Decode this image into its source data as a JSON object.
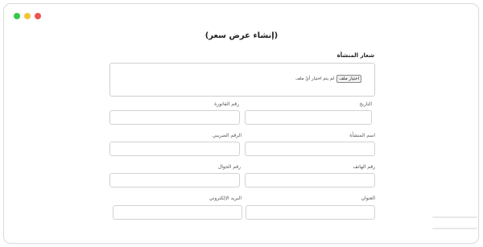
{
  "window": {
    "controls": [
      "green-light",
      "yellow-light",
      "red-light"
    ]
  },
  "page": {
    "title": "(إنشاء عرض سعر)"
  },
  "logo_section": {
    "label": "شعار المنشأة",
    "file_button": "اختيار ملف",
    "file_status": "لم يتم اختيار أيّ ملف"
  },
  "fields": {
    "date": {
      "label": "التاريخ"
    },
    "invoice_number": {
      "label": "رقم الفاتورة"
    },
    "establishment_name": {
      "label": "اسم المنشأة"
    },
    "tax_number": {
      "label": "الرقم الضريبي"
    },
    "phone_number": {
      "label": "رقم الهاتف"
    },
    "mobile_number": {
      "label": "رقم الجوال"
    },
    "address": {
      "label": "العنوان"
    },
    "email": {
      "label": "البريد الإلكتروني"
    }
  }
}
